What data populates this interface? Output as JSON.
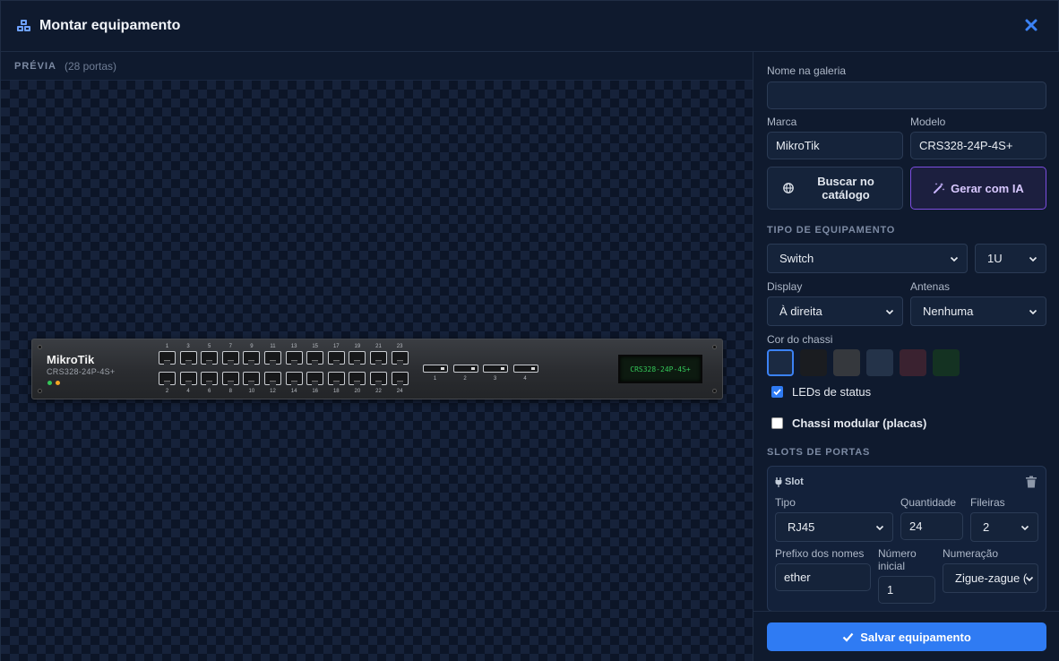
{
  "header": {
    "title": "Montar equipamento"
  },
  "preview": {
    "label": "PRÉVIA",
    "count": "(28 portas)",
    "device": {
      "brand": "MikroTik",
      "model": "CRS328-24P-4S+",
      "lcd_text": "CRS328-24P-4S+",
      "ports_top": [
        "1",
        "3",
        "5",
        "7",
        "9",
        "11",
        "13",
        "15",
        "17",
        "19",
        "21",
        "23"
      ],
      "ports_bottom": [
        "2",
        "4",
        "6",
        "8",
        "10",
        "12",
        "14",
        "16",
        "18",
        "20",
        "22",
        "24"
      ],
      "sfp": [
        "1",
        "2",
        "3",
        "4"
      ],
      "led_colors": [
        "#34c759",
        "#f5a623"
      ]
    }
  },
  "form": {
    "gallery_name": {
      "label": "Nome na galeria",
      "value": ""
    },
    "brand": {
      "label": "Marca",
      "value": "MikroTik"
    },
    "model": {
      "label": "Modelo",
      "value": "CRS328-24P-4S+"
    },
    "catalog_button": "Buscar no catálogo",
    "ai_button": "Gerar com IA",
    "type_section": "TIPO DE EQUIPAMENTO",
    "type": "Switch",
    "units": "1U",
    "display": {
      "label": "Display",
      "value": "À direita"
    },
    "antennas": {
      "label": "Antenas",
      "value": "Nenhuma"
    },
    "chassis_color": {
      "label": "Cor do chassi",
      "options": [
        "#1b2a42",
        "#1a1c20",
        "#35383d",
        "#243349",
        "#3a2230",
        "#143222"
      ],
      "selected": 0
    },
    "status_leds": {
      "label": "LEDs de status",
      "checked": true
    },
    "modular": {
      "label": "Chassi modular (placas)",
      "checked": false
    },
    "slots_section": "SLOTS DE PORTAS",
    "slot": {
      "title": "Slot",
      "type": {
        "label": "Tipo",
        "value": "RJ45"
      },
      "quantity": {
        "label": "Quantidade",
        "value": "24"
      },
      "rows": {
        "label": "Fileiras",
        "value": "2"
      },
      "prefix": {
        "label": "Prefixo dos nomes",
        "value": "ether"
      },
      "start_number": {
        "label": "Número inicial",
        "value": "1"
      },
      "numbering": {
        "label": "Numeração",
        "value": "Zigue-zague ("
      }
    }
  },
  "footer": {
    "save": "Salvar equipamento"
  },
  "colors": {
    "accent": "#2f7bf3",
    "ai": "#7c4ddf"
  }
}
